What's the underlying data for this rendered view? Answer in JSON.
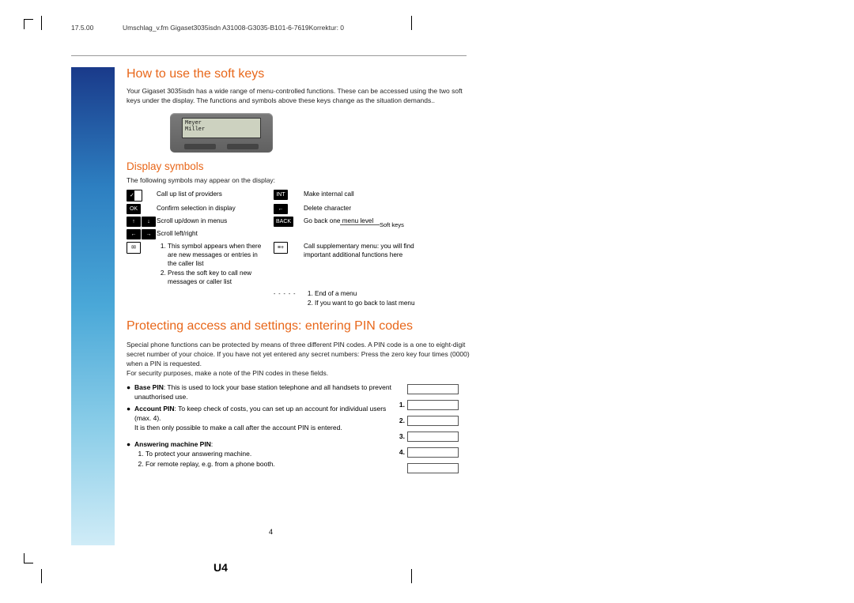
{
  "header": {
    "date": "17.5.00",
    "docinfo": "Umschlag_v.fm   Gigaset3035isdn    A31008-G3035-B101-6-7619Korrektur: 0"
  },
  "softkeys": {
    "heading": "How to use the soft keys",
    "intro": "Your Gigaset 3035isdn has a wide range of menu-controlled functions. These can be accessed using the two soft keys under the display. The functions and symbols above these keys change as the situation demands..",
    "phone": {
      "line1": "Meyer",
      "line2": "Miller"
    },
    "caption": "Soft keys"
  },
  "display": {
    "heading": "Display symbols",
    "intro": "The following symbols may appear on the display:",
    "left": [
      {
        "sym": "checks",
        "text": "Call up list of providers"
      },
      {
        "sym": "OK",
        "text": "Confirm selection in display"
      },
      {
        "sym": "updown",
        "text": "Scroll up/down in menus"
      },
      {
        "sym": "leftright",
        "text": "Scroll left/right"
      },
      {
        "sym": "mail",
        "list": [
          "This symbol appears when there are new messages or entries in the caller list",
          "Press the soft key to call new messages or caller list"
        ]
      }
    ],
    "right": [
      {
        "sym": "INT",
        "text": "Make internal call"
      },
      {
        "sym": "back-arrow",
        "text": "Delete character"
      },
      {
        "sym": "BACK",
        "text": "Go back one menu level"
      },
      {
        "sym": "menu-plus",
        "text": "Call supplementary menu: you will find important additional functions here"
      },
      {
        "sym": "dashes",
        "list": [
          "End of a menu",
          "If you want to go back to last menu"
        ]
      }
    ]
  },
  "pin": {
    "heading": "Protecting access and settings: entering PIN codes",
    "p1": "Special phone functions can be protected by means of three different PIN codes. A PIN code is a one to eight-digit secret number of your choice. If you have not yet entered any secret numbers: Press the zero key four times (0000) when a PIN is requested.",
    "p2": "For security purposes, make a note of the PIN codes in these fields.",
    "items": [
      {
        "label": "Base PIN",
        "text": ": This is used to lock your base station telephone and all handsets to prevent unauthorised use."
      },
      {
        "label": "Account PIN",
        "text": ": To keep check of costs, you can set up an account for individual users (max. 4).",
        "text2": "It is then only possible to make a call after the account PIN is entered."
      },
      {
        "label": "Answering machine PIN",
        "text": ":",
        "sub": [
          "To protect your answering machine.",
          "For remote replay, e.g. from a phone booth."
        ]
      }
    ],
    "field_nums": [
      "",
      "1.",
      "2.",
      "3.",
      "4.",
      ""
    ]
  },
  "footer": {
    "pagenum": "4",
    "pagelabel": "U4"
  }
}
